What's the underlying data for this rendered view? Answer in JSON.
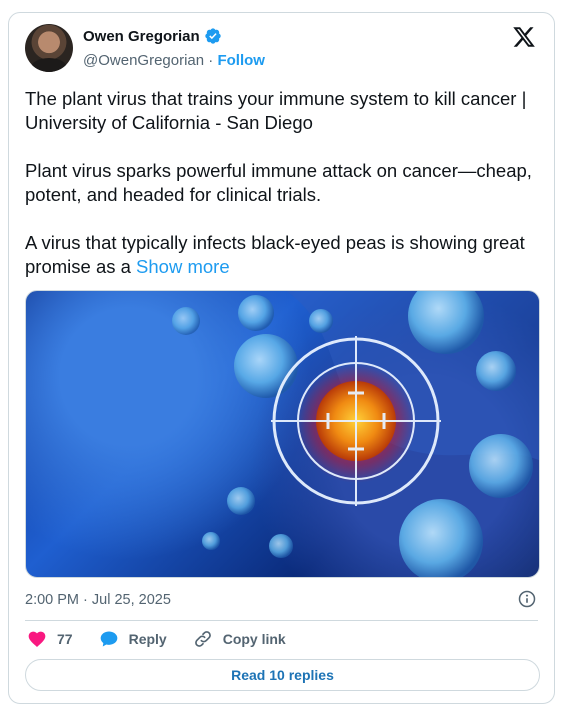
{
  "author": {
    "name": "Owen Gregorian",
    "handle": "@OwenGregorian",
    "separator": "·",
    "follow_label": "Follow",
    "verified": true
  },
  "tweet": {
    "paragraphs": [
      "The plant virus that trains your immune system to kill cancer | University of California - San Diego",
      "Plant virus sparks powerful immune attack on cancer—cheap, potent, and headed for clinical trials.",
      "A virus that typically infects black-eyed peas is showing great promise as a "
    ],
    "show_more": "Show more"
  },
  "timestamp": "2:00 PM · Jul 25, 2025",
  "actions": {
    "likes": "77",
    "reply_label": "Reply",
    "copy_link_label": "Copy link"
  },
  "read_replies_label": "Read 10 replies",
  "colors": {
    "accent": "#1d9bf0",
    "like": "#f91880",
    "text": "#0f1419",
    "muted": "#536471",
    "border": "#cfd9de"
  },
  "icons": [
    "verified-badge-icon",
    "x-logo-icon",
    "info-icon",
    "heart-icon",
    "reply-bubble-icon",
    "link-icon"
  ]
}
